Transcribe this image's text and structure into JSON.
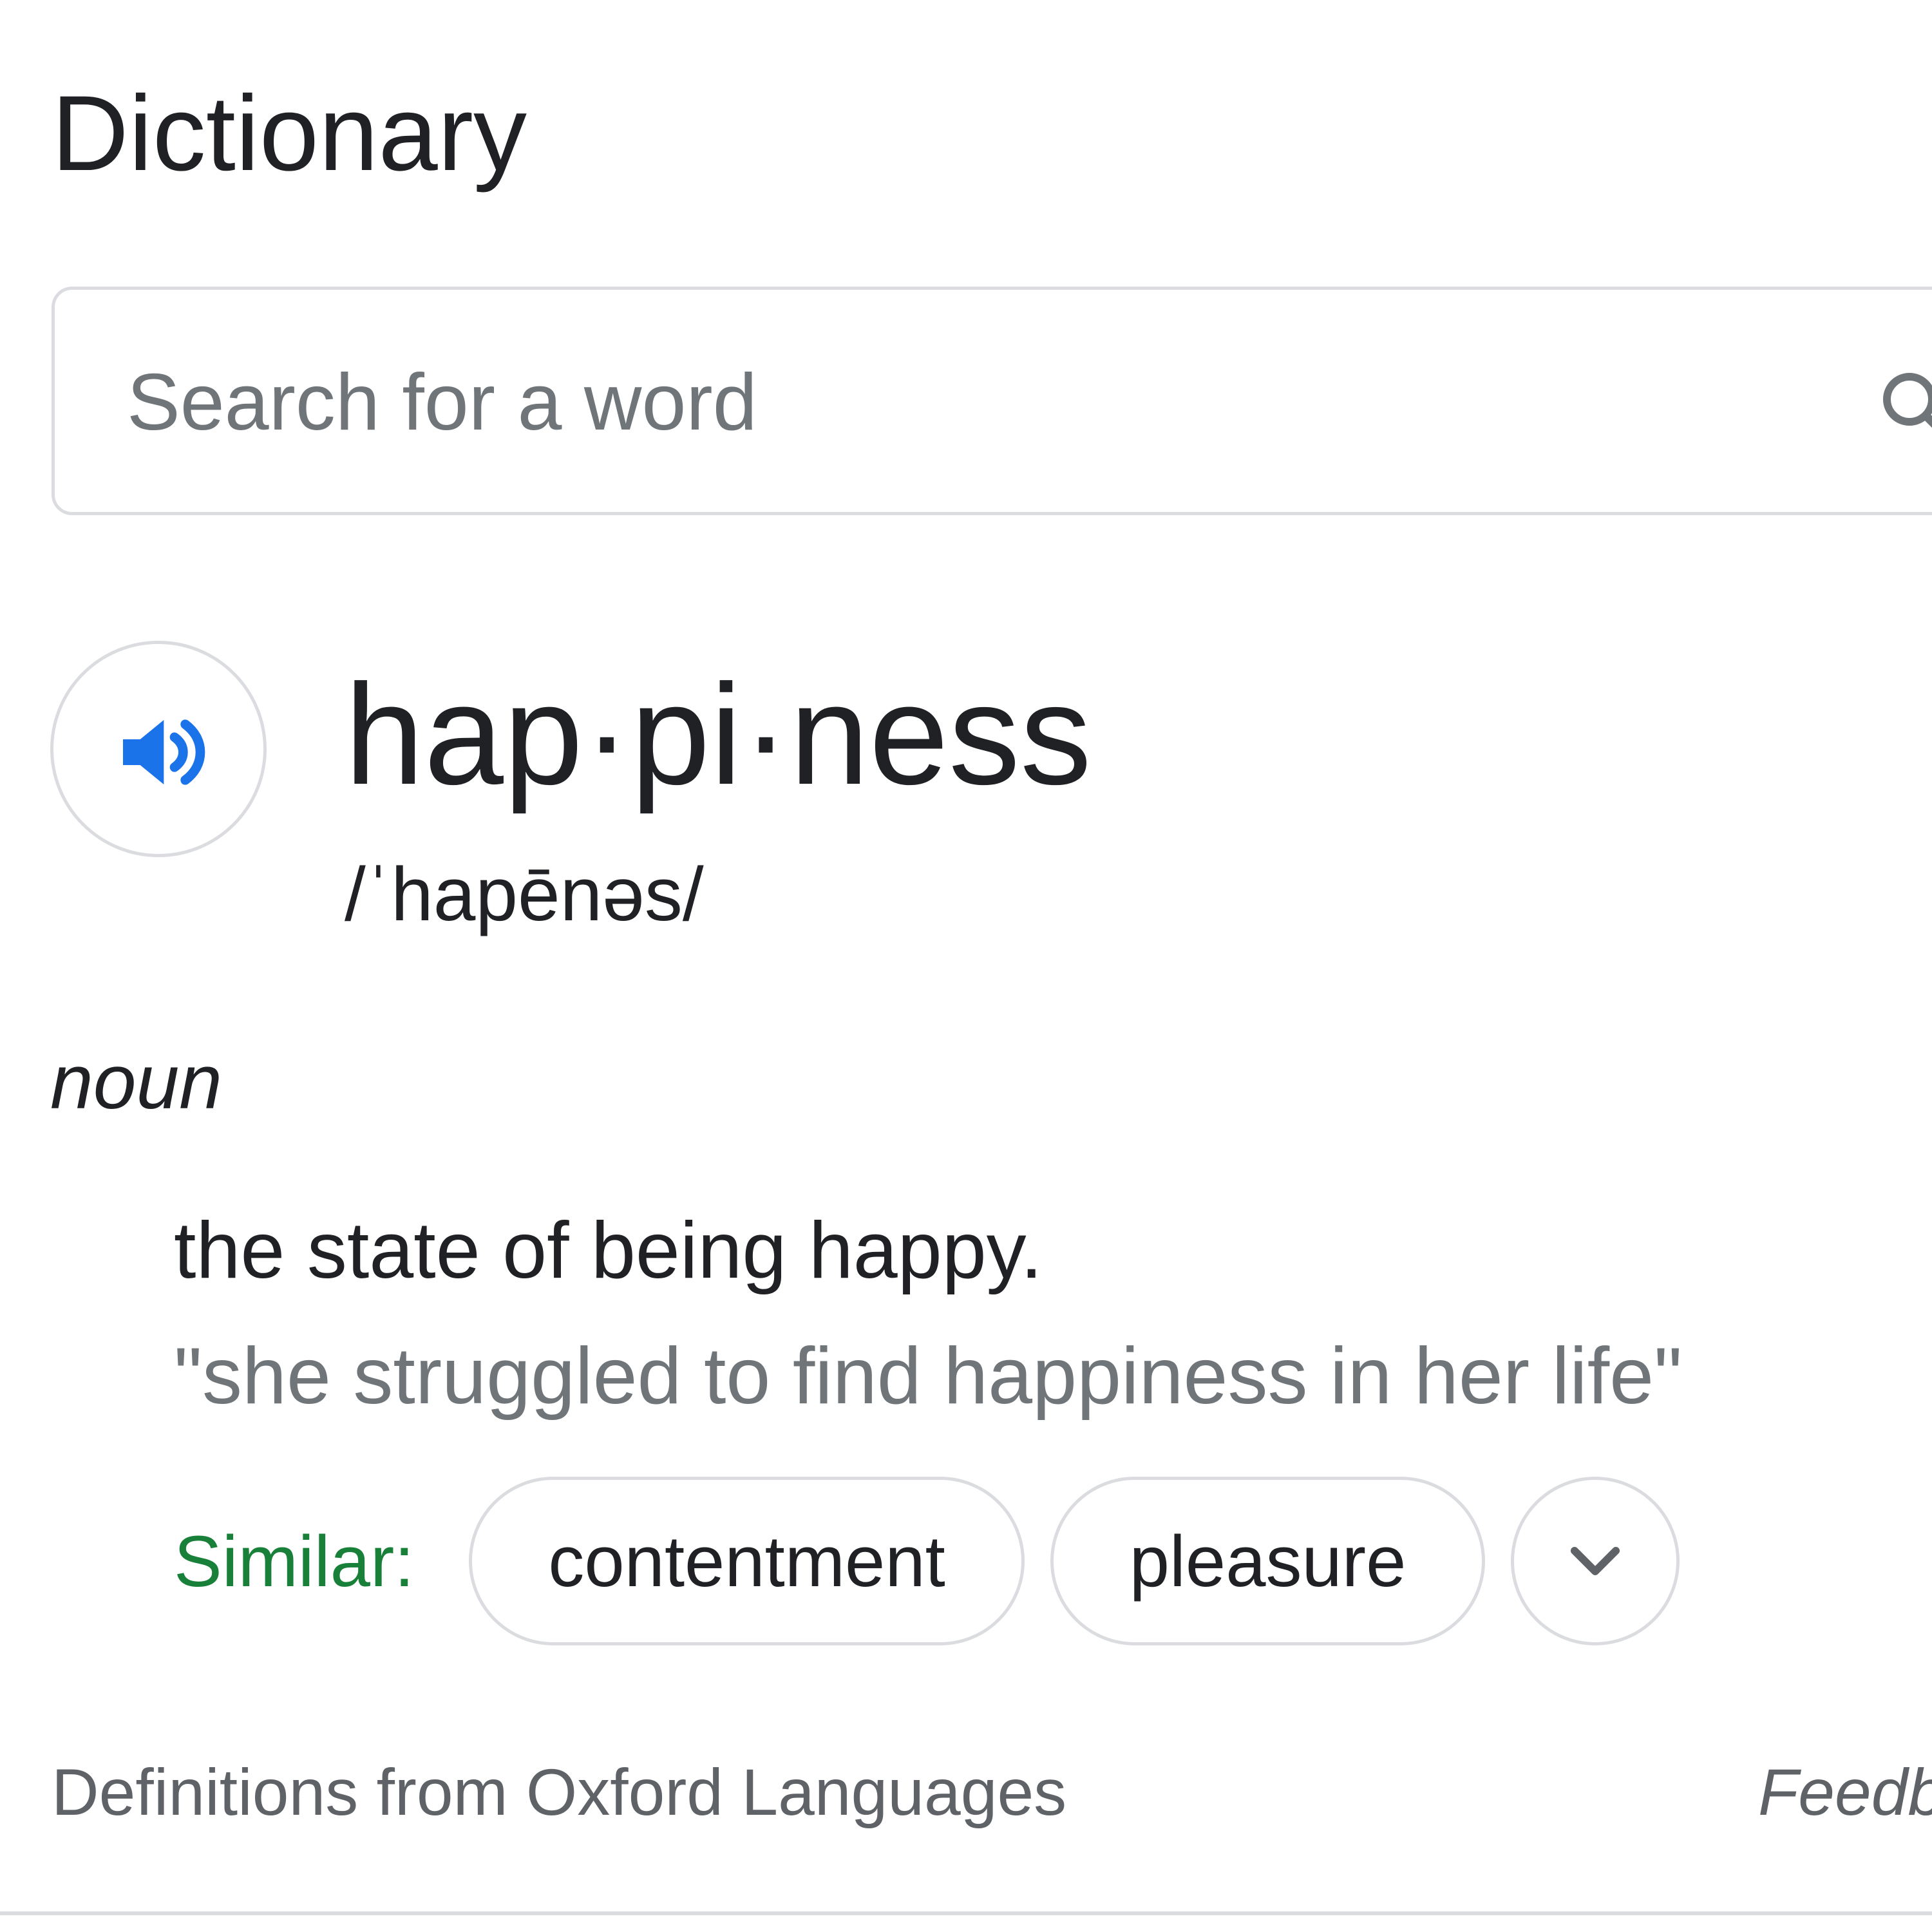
{
  "widget": {
    "title": "Dictionary"
  },
  "search": {
    "placeholder": "Search for a word",
    "value": "",
    "icon": "search-icon"
  },
  "entry": {
    "audio_icon": "speaker-icon",
    "headword": "hap·pi·ness",
    "pronunciation": "/ˈhapēnəs/",
    "part_of_speech": "noun",
    "definition": "the state of being happy.",
    "example": "\"she struggled to find happiness in her life\"",
    "similar": {
      "label": "Similar:",
      "chips": [
        "contentment",
        "pleasure"
      ],
      "expand_icon": "chevron-down-icon"
    }
  },
  "footer": {
    "source": "Definitions from Oxford Languages",
    "feedback": "Feedb"
  },
  "colors": {
    "accent_blue": "#1a73e8",
    "similar_green": "#188038",
    "text_primary": "#202124",
    "text_secondary": "#70757a",
    "border": "#dadce0"
  }
}
